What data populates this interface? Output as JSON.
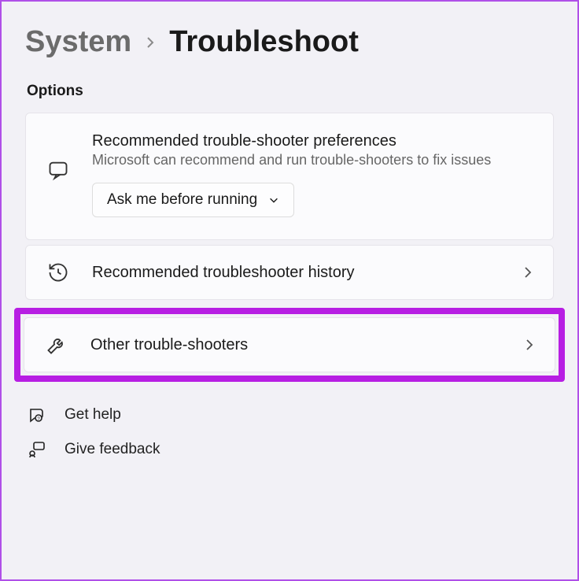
{
  "breadcrumb": {
    "parent": "System",
    "current": "Troubleshoot"
  },
  "section_label": "Options",
  "prefs": {
    "title": "Recommended trouble-shooter preferences",
    "subtitle": "Microsoft can recommend and run trouble-shooters to fix issues",
    "dropdown_value": "Ask me before running"
  },
  "history": {
    "title": "Recommended troubleshooter history"
  },
  "other": {
    "title": "Other trouble-shooters"
  },
  "footer": {
    "get_help": "Get help",
    "give_feedback": "Give feedback"
  }
}
